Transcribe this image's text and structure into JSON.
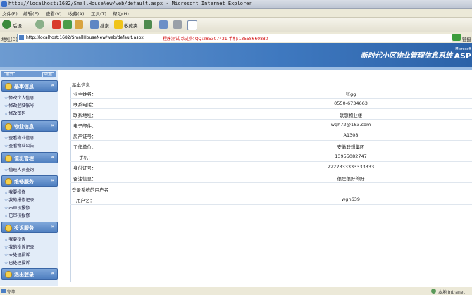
{
  "window": {
    "title": "http://localhost:1682/SmallHouseNew/web/default.aspx - Microsoft Internet Explorer"
  },
  "menu": [
    "文件(F)",
    "编辑(E)",
    "查看(V)",
    "收藏(A)",
    "工具(T)",
    "帮助(H)"
  ],
  "toolbar": {
    "back_label": "后退",
    "search_label": "搜索",
    "favorites_label": "收藏夹"
  },
  "address": {
    "label": "地址(D)",
    "url": "http://localhost:1682/SmallHouseNew/web/default.aspx",
    "ticker": "程序测试 欢迎你 QQ:285307421 手机:13558660880",
    "go_label": "链接"
  },
  "banner": {
    "title": "新时代小区物业管理信息系统",
    "logo_small": "Microsoft",
    "logo_big": "ASP"
  },
  "sidebar": {
    "top_buttons": [
      "展开",
      "收起"
    ],
    "groups": [
      {
        "title": "基本信息",
        "items": [
          "修改个人信息",
          "修改登陆帐号",
          "修改密码"
        ]
      },
      {
        "title": "物业信息",
        "items": [
          "查看物业信息",
          "查看物业公告"
        ]
      },
      {
        "title": "值班管理",
        "items": [
          "值班人员查询"
        ]
      },
      {
        "title": "维修服务",
        "items": [
          "我要报修",
          "我的报修记录",
          "未审核报修",
          "已审核报修"
        ]
      },
      {
        "title": "投诉服务",
        "items": [
          "我要投诉",
          "我的投诉记录",
          "未处理投诉",
          "已处理投诉"
        ]
      },
      {
        "title": "退出登录",
        "items": []
      }
    ]
  },
  "content": {
    "section1_title": "基本信息",
    "rows": [
      {
        "label": "业主姓名：",
        "value": "张gg"
      },
      {
        "label": "联系电话：",
        "value": "0550-6734663"
      },
      {
        "label": "联系地址：",
        "value": "联想物业楼"
      },
      {
        "label": "电子邮件：",
        "value": "wgh72@163.com"
      },
      {
        "label": "房产证号：",
        "value": "A1308"
      },
      {
        "label": "工作单位：",
        "value": "安徽联想集团"
      },
      {
        "label": "手机：",
        "value": "13955082747"
      },
      {
        "label": "身份证号：",
        "value": "2222333333333333"
      },
      {
        "label": "备注信息：",
        "value": "很是很好的好"
      }
    ],
    "section2_title": "登录系统的用户名",
    "user_row": {
      "label": "用户名：",
      "value": "wgh639"
    }
  },
  "status": {
    "left": "完毕",
    "right": "本地 Intranet"
  }
}
